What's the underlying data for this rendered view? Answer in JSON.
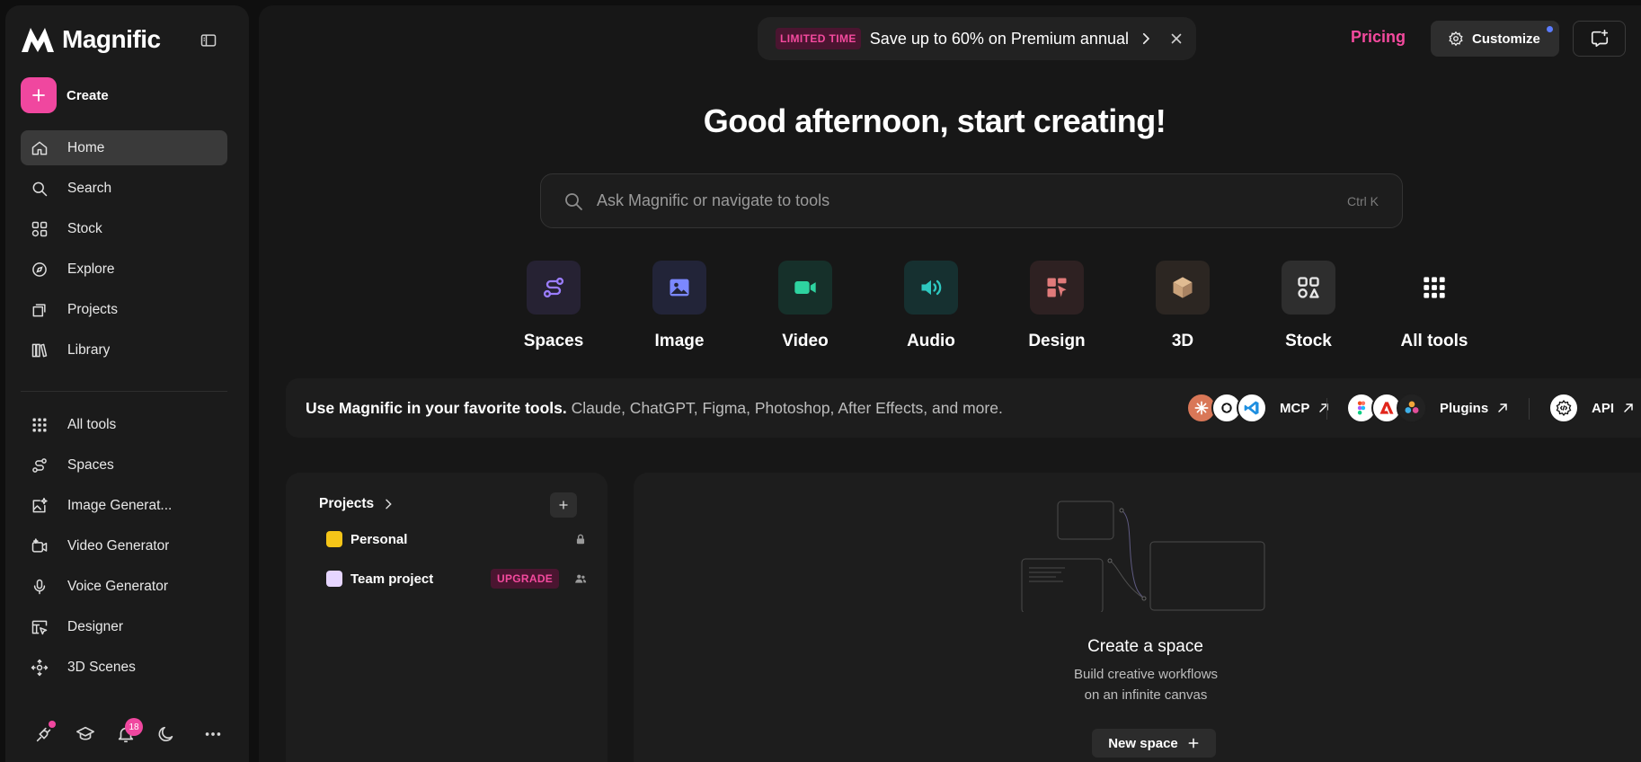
{
  "app": {
    "name": "Magnific"
  },
  "sidebar": {
    "create_label": "Create",
    "main_items": [
      {
        "label": "Home",
        "icon": "home-icon",
        "active": true
      },
      {
        "label": "Search",
        "icon": "search-icon"
      },
      {
        "label": "Stock",
        "icon": "stock-icon"
      },
      {
        "label": "Explore",
        "icon": "compass-icon"
      },
      {
        "label": "Projects",
        "icon": "projects-icon"
      },
      {
        "label": "Library",
        "icon": "library-icon"
      }
    ],
    "tool_items": [
      {
        "label": "All tools",
        "icon": "grid-icon"
      },
      {
        "label": "Spaces",
        "icon": "spaces-icon"
      },
      {
        "label": "Image Generat...",
        "icon": "image-generator-icon"
      },
      {
        "label": "Video Generator",
        "icon": "video-generator-icon"
      },
      {
        "label": "Voice Generator",
        "icon": "microphone-icon"
      },
      {
        "label": "Designer",
        "icon": "designer-icon"
      },
      {
        "label": "3D Scenes",
        "icon": "3d-scenes-icon"
      }
    ],
    "notification_count": "18"
  },
  "header": {
    "promo_badge": "LIMITED TIME",
    "promo_text": "Save up to 60% on Premium annual",
    "pricing_label": "Pricing",
    "customize_label": "Customize"
  },
  "main": {
    "greeting": "Good afternoon, start creating!",
    "search_placeholder": "Ask Magnific or navigate to tools",
    "search_shortcut": "Ctrl K",
    "tools": [
      {
        "label": "Spaces",
        "icon": "spaces-icon",
        "color": "#9b7dff"
      },
      {
        "label": "Image",
        "icon": "image-icon",
        "color": "#7b88ff"
      },
      {
        "label": "Video",
        "icon": "video-icon",
        "color": "#2ed3a0"
      },
      {
        "label": "Audio",
        "icon": "audio-icon",
        "color": "#2ec8c0"
      },
      {
        "label": "Design",
        "icon": "design-icon",
        "color": "#e07a7a"
      },
      {
        "label": "3D",
        "icon": "cube-icon",
        "color": "#c9a17a"
      },
      {
        "label": "Stock",
        "icon": "stock-icon",
        "color": "#e8e8e8"
      },
      {
        "label": "All tools",
        "icon": "grid-icon",
        "color": "#ffffff"
      }
    ],
    "integrations": {
      "headline": "Use Magnific in your favorite tools.",
      "subtext": "Claude, ChatGPT, Figma, Photoshop, After Effects, and more.",
      "mcp_label": "MCP",
      "plugins_label": "Plugins",
      "api_label": "API"
    },
    "projects": {
      "title": "Projects",
      "items": [
        {
          "name": "Personal",
          "color": "#f5c518"
        },
        {
          "name": "Team project",
          "color": "#e6d5ff",
          "badge": "UPGRADE"
        }
      ]
    },
    "space": {
      "title": "Create a space",
      "description": "Build creative workflows on an infinite canvas",
      "button_label": "New space"
    }
  },
  "colors": {
    "accent": "#f0479f",
    "background": "#171717",
    "sidebar": "#1b1b1b"
  }
}
